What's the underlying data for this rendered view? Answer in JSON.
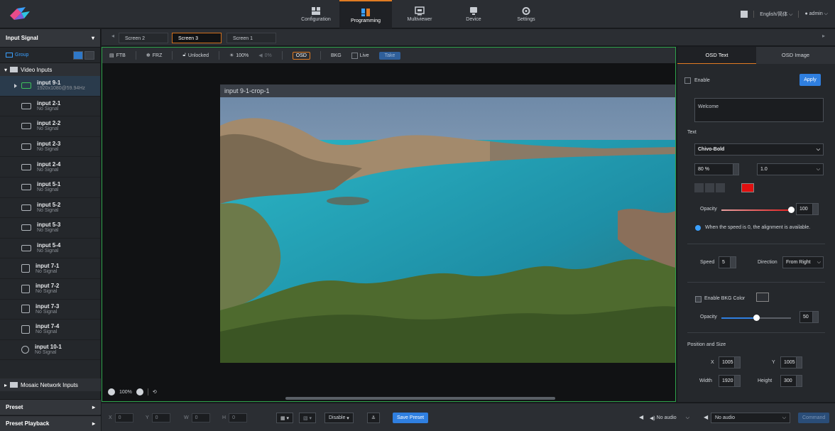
{
  "topbar": {
    "nav": [
      {
        "label": "Configuration",
        "icon": "configuration-icon"
      },
      {
        "label": "Programming",
        "icon": "programming-icon",
        "active": true
      },
      {
        "label": "Multiviewer",
        "icon": "multiviewer-icon"
      },
      {
        "label": "Device",
        "icon": "device-icon"
      },
      {
        "label": "Settings",
        "icon": "settings-icon"
      }
    ],
    "language": "English/简体",
    "user": "admin"
  },
  "left": {
    "header": "Input Signal",
    "group_label": "Group",
    "category_video": "Video Inputs",
    "inputs": [
      {
        "name": "input 9-1",
        "status": "1920x1080@59.94Hz",
        "icon": "hdmi-icon"
      },
      {
        "name": "input 2-1",
        "status": "No Signal",
        "icon": "hdmi-icon"
      },
      {
        "name": "input 2-2",
        "status": "No Signal",
        "icon": "hdmi-icon"
      },
      {
        "name": "input 2-3",
        "status": "No Signal",
        "icon": "hdmi-icon"
      },
      {
        "name": "input 2-4",
        "status": "No Signal",
        "icon": "hdmi-icon"
      },
      {
        "name": "input 5-1",
        "status": "No Signal",
        "icon": "hdmi-icon"
      },
      {
        "name": "input 5-2",
        "status": "No Signal",
        "icon": "hdmi-icon"
      },
      {
        "name": "input 5-3",
        "status": "No Signal",
        "icon": "hdmi-icon"
      },
      {
        "name": "input 5-4",
        "status": "No Signal",
        "icon": "hdmi-icon"
      },
      {
        "name": "input 7-1",
        "status": "No Signal",
        "icon": "dp-icon"
      },
      {
        "name": "input 7-2",
        "status": "No Signal",
        "icon": "dp-icon"
      },
      {
        "name": "input 7-3",
        "status": "No Signal",
        "icon": "dp-icon"
      },
      {
        "name": "input 7-4",
        "status": "No Signal",
        "icon": "dp-icon"
      },
      {
        "name": "input 10-1",
        "status": "No Signal",
        "icon": "sdi-icon"
      }
    ],
    "category_mosaic": "Mosaic Network Inputs",
    "preset": "Preset",
    "preset_playback": "Preset Playback"
  },
  "screens": [
    "Screen 2",
    "Screen 3",
    "Screen 1"
  ],
  "canvas": {
    "toolbar": {
      "ftb": "FTB",
      "frz": "FRZ",
      "lock": "Unlocked",
      "brightness": "100%",
      "volume": "0%",
      "osd": "OSD",
      "bkg": "BKG",
      "live": "Live",
      "take": "Take"
    },
    "window_title": "input 9-1-crop-1",
    "zoom": "100%"
  },
  "osd": {
    "tabs": [
      "OSD Text",
      "OSD Image"
    ],
    "enable": "Enable",
    "apply": "Apply",
    "text_value": "Welcome",
    "text_label": "Text",
    "font": "Chivo-Bold",
    "size": "80 %",
    "line_spacing": "1.0",
    "text_color": "#e01010",
    "opacity_label": "Opacity",
    "opacity": "100",
    "opacity_fraction": 1.0,
    "info": "When the speed is 0, the alignment is available.",
    "speed_label": "Speed",
    "speed": "5",
    "direction_label": "Direction",
    "direction": "From Right",
    "bkg_color_label": "Enable BKG Color",
    "bkg_opacity_label": "Opacity",
    "bkg_opacity": "50",
    "bkg_opacity_fraction": 0.5,
    "pos_size_label": "Position and Size",
    "x_label": "X",
    "x": "1005",
    "y_label": "Y",
    "y": "1005",
    "width_label": "Width",
    "width": "1920",
    "height_label": "Height",
    "height": "300"
  },
  "bottom": {
    "x_label": "X",
    "x": "0",
    "y_label": "Y",
    "y": "0",
    "w_label": "W",
    "w": "0",
    "h_label": "H",
    "h": "0",
    "disable": "Disable",
    "save_preset": "Save Preset",
    "audio1": "No audio",
    "audio2": "No audio",
    "command": "Command"
  }
}
